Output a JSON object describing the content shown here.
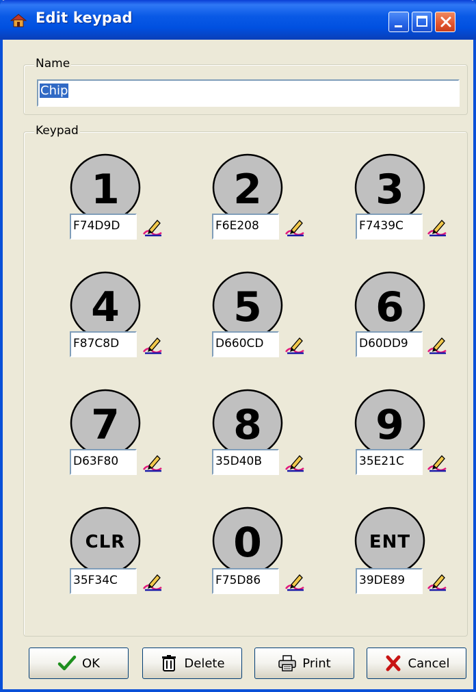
{
  "window": {
    "title": "Edit keypad"
  },
  "name_group": {
    "label": "Name",
    "value": "Chip"
  },
  "keypad_group": {
    "label": "Keypad",
    "keys": [
      {
        "label": "1",
        "code": "F74D9D"
      },
      {
        "label": "2",
        "code": "F6E208"
      },
      {
        "label": "3",
        "code": "F7439C"
      },
      {
        "label": "4",
        "code": "F87C8D"
      },
      {
        "label": "5",
        "code": "D660CD"
      },
      {
        "label": "6",
        "code": "D60DD9"
      },
      {
        "label": "7",
        "code": "D63F80"
      },
      {
        "label": "8",
        "code": "35D40B"
      },
      {
        "label": "9",
        "code": "35E21C"
      },
      {
        "label": "CLR",
        "code": "35F34C"
      },
      {
        "label": "0",
        "code": "F75D86"
      },
      {
        "label": "ENT",
        "code": "39DE89"
      }
    ]
  },
  "buttons": {
    "ok": "OK",
    "delete": "Delete",
    "print": "Print",
    "cancel": "Cancel"
  },
  "icons": {
    "ok": "checkmark-icon",
    "delete": "trash-icon",
    "print": "printer-icon",
    "cancel": "x-icon",
    "edit": "pen-edit-icon",
    "app": "app-icon"
  },
  "colors": {
    "titlebar": "#0a5ae6",
    "dialog_bg": "#ece9d8",
    "key_fill": "#c0c0c0",
    "selection": "#316ac5"
  }
}
